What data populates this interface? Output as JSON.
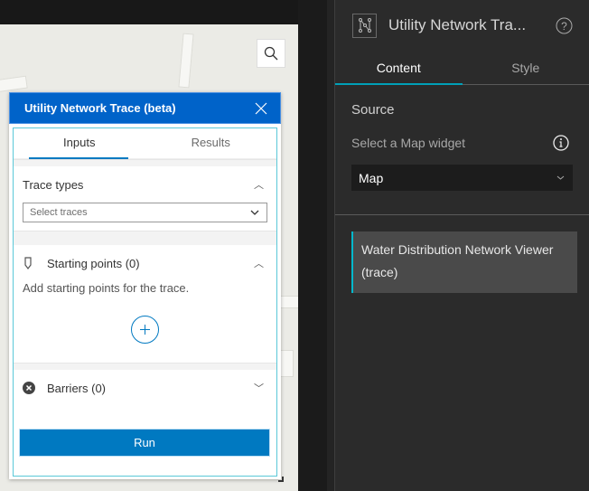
{
  "widget": {
    "title": "Utility Network Trace (beta)",
    "tabs": [
      "Inputs",
      "Results"
    ],
    "trace_types": {
      "label": "Trace types",
      "placeholder": "Select traces"
    },
    "starting_points": {
      "label": "Starting points (0)",
      "hint": "Add starting points for the trace."
    },
    "barriers": {
      "label": "Barriers (0)"
    },
    "run_label": "Run"
  },
  "settings": {
    "title": "Utility Network Tra...",
    "tabs": [
      "Content",
      "Style"
    ],
    "source_label": "Source",
    "select_map_label": "Select a Map widget",
    "map_value": "Map",
    "data_source": "Water Distribution Network Viewer (trace)"
  },
  "colors": {
    "header": "#0063c9",
    "run": "#0079c1",
    "accent": "#00a0b8"
  }
}
